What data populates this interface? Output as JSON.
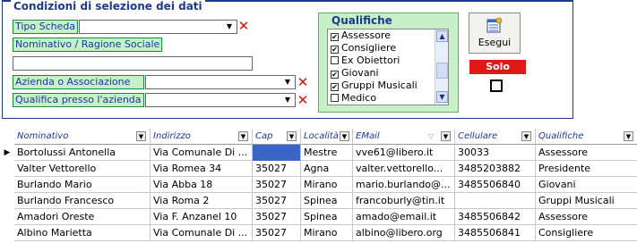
{
  "selection": {
    "title": "Condizioni di selezione dei dati",
    "tipo_scheda": {
      "label": "Tipo Scheda",
      "value": ""
    },
    "nominativo": {
      "label": "Nominativo / Ragione Sociale",
      "value": ""
    },
    "azienda": {
      "label": "Azienda o Associazione",
      "value": ""
    },
    "qualifica_azienda": {
      "label": "Qualifica presso l'azienda",
      "value": ""
    }
  },
  "qualifiche": {
    "title": "Qualifiche",
    "items": [
      {
        "label": "Assessore",
        "checked": true
      },
      {
        "label": "Consigliere",
        "checked": true
      },
      {
        "label": "Ex Obiettori",
        "checked": false
      },
      {
        "label": "Giovani",
        "checked": true
      },
      {
        "label": "Gruppi Musicali",
        "checked": true
      },
      {
        "label": "Medico",
        "checked": false
      }
    ]
  },
  "actions": {
    "esegui_label": "Esegui",
    "solo_attivi_label": "Solo Attivi"
  },
  "grid": {
    "columns": [
      "Nominativo",
      "Indirizzo",
      "Cap",
      "Località",
      "EMail",
      "Cellulare",
      "Qualifiche"
    ],
    "rows": [
      [
        "Bortolussi Antonella",
        "Via Comunale Di ...",
        "",
        "Mestre",
        "vve61@libero.it",
        "30033",
        "Assessore"
      ],
      [
        "Valter Vettorello",
        "Via Romea 34",
        "35027",
        "Agna",
        "valter.vettorello...",
        "3485203882",
        "Presidente"
      ],
      [
        "Burlando Mario",
        "Via Abba 18",
        "35027",
        "Mirano",
        "mario.burlando@...",
        "3485506840",
        "Giovani"
      ],
      [
        "Burlando Francesco",
        "Via Roma 2",
        "35027",
        "Spinea",
        "francoburly@tin.it",
        "",
        "Gruppi Musicali"
      ],
      [
        "Amadori Oreste",
        "Via F. Anzanel 10",
        "35027",
        "Spinea",
        "amado@email.it",
        "3485506842",
        "Assessore"
      ],
      [
        "Albino Marietta",
        "Via Comunale Di ...",
        "35027",
        "Mirano",
        "albino@libero.org",
        "3485506841",
        "Consigliere"
      ]
    ]
  }
}
